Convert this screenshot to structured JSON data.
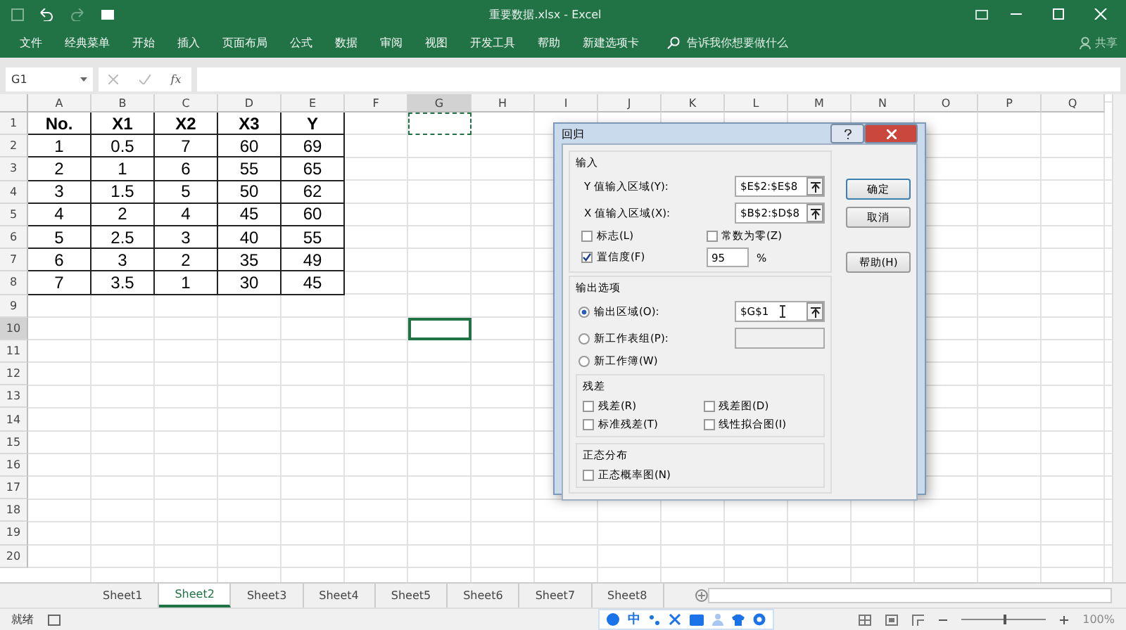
{
  "title_bar": {
    "title": "重要数据.xlsx - Excel"
  },
  "ribbon": {
    "tabs": [
      "文件",
      "经典菜单",
      "开始",
      "插入",
      "页面布局",
      "公式",
      "数据",
      "审阅",
      "视图",
      "开发工具",
      "帮助",
      "新建选项卡"
    ],
    "search_placeholder": "告诉我你想要做什么",
    "share": "共享"
  },
  "formula_bar": {
    "name_box": "G1",
    "fx": "fx"
  },
  "grid": {
    "columns": [
      {
        "label": "A",
        "selected": false
      },
      {
        "label": "B",
        "selected": false
      },
      {
        "label": "C",
        "selected": false
      },
      {
        "label": "D",
        "selected": false
      },
      {
        "label": "E",
        "selected": false
      },
      {
        "label": "F",
        "selected": false
      },
      {
        "label": "G",
        "selected": true
      },
      {
        "label": "H",
        "selected": false
      },
      {
        "label": "I",
        "selected": false
      },
      {
        "label": "J",
        "selected": false
      },
      {
        "label": "K",
        "selected": false
      },
      {
        "label": "L",
        "selected": false
      },
      {
        "label": "M",
        "selected": false
      },
      {
        "label": "N",
        "selected": false
      },
      {
        "label": "O",
        "selected": false
      },
      {
        "label": "P",
        "selected": false
      },
      {
        "label": "Q",
        "selected": false
      }
    ],
    "rows": [
      {
        "number": "1",
        "selected": false,
        "marquee": true,
        "cells": [
          "No.",
          "X1",
          "X2",
          "X3",
          "Y"
        ]
      },
      {
        "number": "2",
        "selected": false,
        "marquee": false,
        "cells": [
          "1",
          "0.5",
          "7",
          "60",
          "69"
        ]
      },
      {
        "number": "3",
        "selected": false,
        "marquee": false,
        "cells": [
          "2",
          "1",
          "6",
          "55",
          "65"
        ]
      },
      {
        "number": "4",
        "selected": false,
        "marquee": false,
        "cells": [
          "3",
          "1.5",
          "5",
          "50",
          "62"
        ]
      },
      {
        "number": "5",
        "selected": false,
        "marquee": false,
        "cells": [
          "4",
          "2",
          "4",
          "45",
          "60"
        ]
      },
      {
        "number": "6",
        "selected": false,
        "marquee": false,
        "cells": [
          "5",
          "2.5",
          "3",
          "40",
          "55"
        ]
      },
      {
        "number": "7",
        "selected": false,
        "marquee": false,
        "cells": [
          "6",
          "3",
          "2",
          "35",
          "49"
        ]
      },
      {
        "number": "8",
        "selected": false,
        "marquee": false,
        "cells": [
          "7",
          "3.5",
          "1",
          "30",
          "45"
        ]
      },
      {
        "number": "9",
        "selected": false,
        "marquee": false,
        "cells": []
      },
      {
        "number": "10",
        "selected": true,
        "marquee": false,
        "cells": []
      },
      {
        "number": "11",
        "selected": false,
        "marquee": false,
        "cells": []
      },
      {
        "number": "12",
        "selected": false,
        "marquee": false,
        "cells": []
      },
      {
        "number": "13",
        "selected": false,
        "marquee": false,
        "cells": []
      },
      {
        "number": "14",
        "selected": false,
        "marquee": false,
        "cells": []
      },
      {
        "number": "15",
        "selected": false,
        "marquee": false,
        "cells": []
      },
      {
        "number": "16",
        "selected": false,
        "marquee": false,
        "cells": []
      },
      {
        "number": "17",
        "selected": false,
        "marquee": false,
        "cells": []
      },
      {
        "number": "18",
        "selected": false,
        "marquee": false,
        "cells": []
      },
      {
        "number": "19",
        "selected": false,
        "marquee": false,
        "cells": []
      },
      {
        "number": "20",
        "selected": false,
        "marquee": false,
        "cells": []
      }
    ]
  },
  "dialog": {
    "title": "回归",
    "input_section": "输入",
    "ranges": [
      {
        "label": "Y 值输入区域(Y):",
        "value": "$E$2:$E$8"
      },
      {
        "label": "X 值输入区域(X):",
        "value": "$B$2:$D$8"
      }
    ],
    "input_checks": [
      {
        "label": "标志(L)",
        "checked": false
      },
      {
        "label": "常数为零(Z)",
        "checked": false
      },
      {
        "label": "置信度(F)",
        "checked": true
      }
    ],
    "confidence": "95",
    "percent": "%",
    "output_section": "输出选项",
    "output_radios": [
      {
        "kind": "field",
        "label": "输出区域(O):",
        "selected": true,
        "value": "$G$1"
      },
      {
        "kind": "field",
        "label": "新工作表组(P):",
        "selected": false
      },
      {
        "kind": "plain",
        "label": "新工作簿(W)",
        "selected": false
      }
    ],
    "residual_section": "残差",
    "residual_checks": [
      {
        "label": "残差(R)",
        "checked": false
      },
      {
        "label": "残差图(D)",
        "checked": false
      },
      {
        "label": "标准残差(T)",
        "checked": false
      },
      {
        "label": "线性拟合图(I)",
        "checked": false
      }
    ],
    "normal_section": "正态分布",
    "normal_checks": [
      {
        "label": "正态概率图(N)",
        "checked": false
      }
    ],
    "buttons": [
      "确定",
      "取消",
      "帮助(H)"
    ]
  },
  "sheet_tabs": [
    {
      "label": "Sheet1",
      "selected": false
    },
    {
      "label": "Sheet2",
      "selected": true
    },
    {
      "label": "Sheet3",
      "selected": false
    },
    {
      "label": "Sheet4",
      "selected": false
    },
    {
      "label": "Sheet5",
      "selected": false
    },
    {
      "label": "Sheet6",
      "selected": false
    },
    {
      "label": "Sheet7",
      "selected": false
    },
    {
      "label": "Sheet8",
      "selected": false
    }
  ],
  "status_bar": {
    "status": "就绪",
    "ime": "中",
    "zoom": {
      "level": 0.5,
      "reading": "100%"
    }
  }
}
